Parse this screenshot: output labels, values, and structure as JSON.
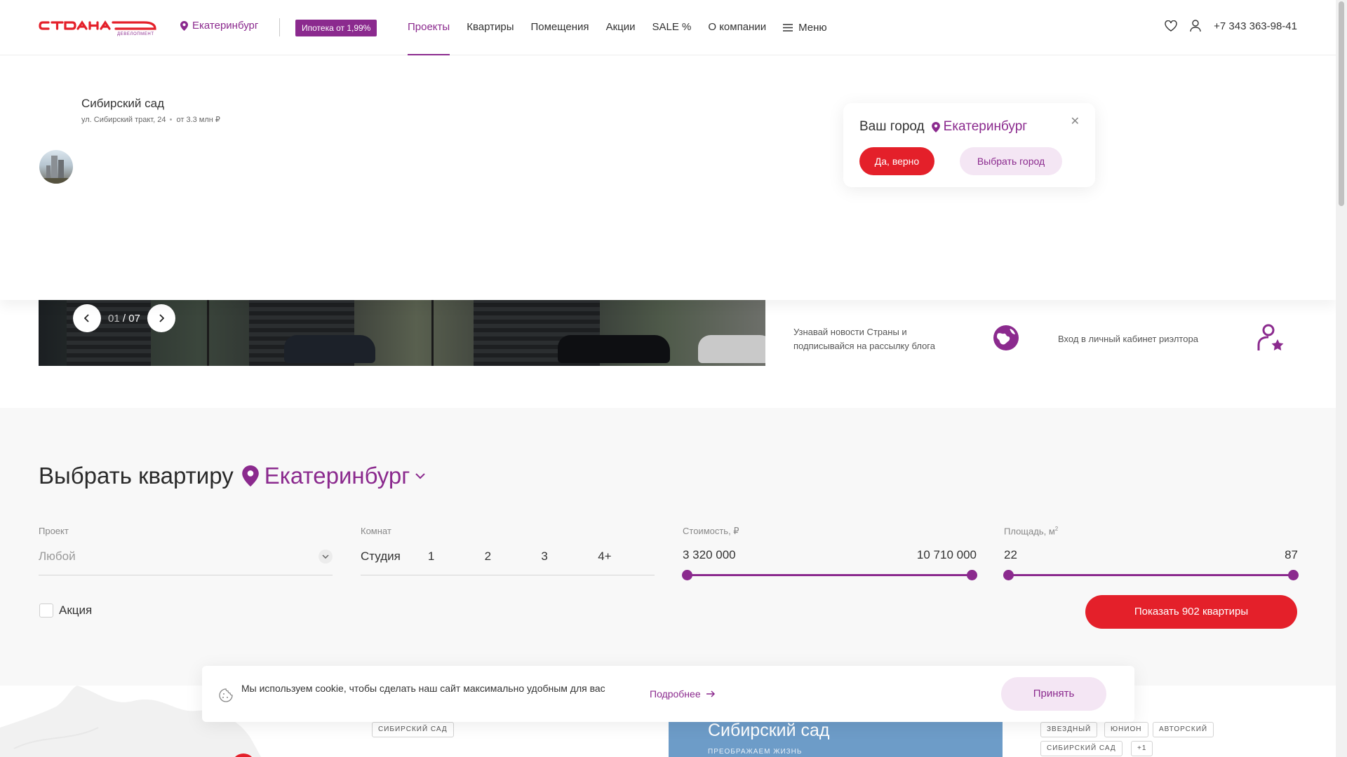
{
  "header": {
    "logo_text": "СТРАНА девелопмент",
    "city": "Екатеринбург",
    "mortgage_badge": "Ипотека от 1,99%",
    "nav": [
      "Проекты",
      "Квартиры",
      "Помещения",
      "Акции",
      "SALE %",
      "О компании"
    ],
    "menu_label": "Меню",
    "phone": "+7 343 363-98-41",
    "colors": {
      "brand_purple": "#8b2a8e",
      "brand_red": "#e4202a"
    }
  },
  "project": {
    "name": "Сибирский сад",
    "address": "ул. Сибирский тракт, 24",
    "price": "от 3.3 млн ₽"
  },
  "city_popup": {
    "question": "Ваш город",
    "city": "Екатеринбург",
    "yes_label": "Да, верно",
    "choose_label": "Выбрать город"
  },
  "slider": {
    "current": "01",
    "separator": "/",
    "total": "07"
  },
  "cards": [
    {
      "text": "Узнавай новости Страны и подписывайся на рассылку блога",
      "icon": "globe-icon"
    },
    {
      "text": "Вход в личный кабинет риэлтора",
      "icon": "realtor-icon"
    }
  ],
  "filter": {
    "title": "Выбрать квартиру",
    "city": "Екатеринбург",
    "project_label": "Проект",
    "project_value": "Любой",
    "rooms_label": "Комнат",
    "rooms": [
      "Студия",
      "1",
      "2",
      "3",
      "4+"
    ],
    "price_label": "Стоимость, ₽",
    "price_min": "3 320 000",
    "price_max": "10 710 000",
    "area_label": "Площадь, м",
    "area_sup": "2",
    "area_min": "22",
    "area_max": "87",
    "promo_label": "Акция",
    "show_button": "Показать 902 квартиры"
  },
  "bottom": {
    "tag_left": "СИБИРСКИЙ САД",
    "card_title": "Сибирский сад",
    "card_subtitle": "ПРЕОБРАЖАЕМ ЖИЗНЬ",
    "tags_right": [
      "ЗВЕЗДНЫЙ",
      "ЮНИОН",
      "АВТОРСКИЙ",
      "СИБИРСКИЙ САД",
      "+1"
    ]
  },
  "cookie": {
    "text": "Мы используем cookie, чтобы сделать наш сайт максимально удобным для вас",
    "more": "Подробнее",
    "accept": "Принять"
  }
}
